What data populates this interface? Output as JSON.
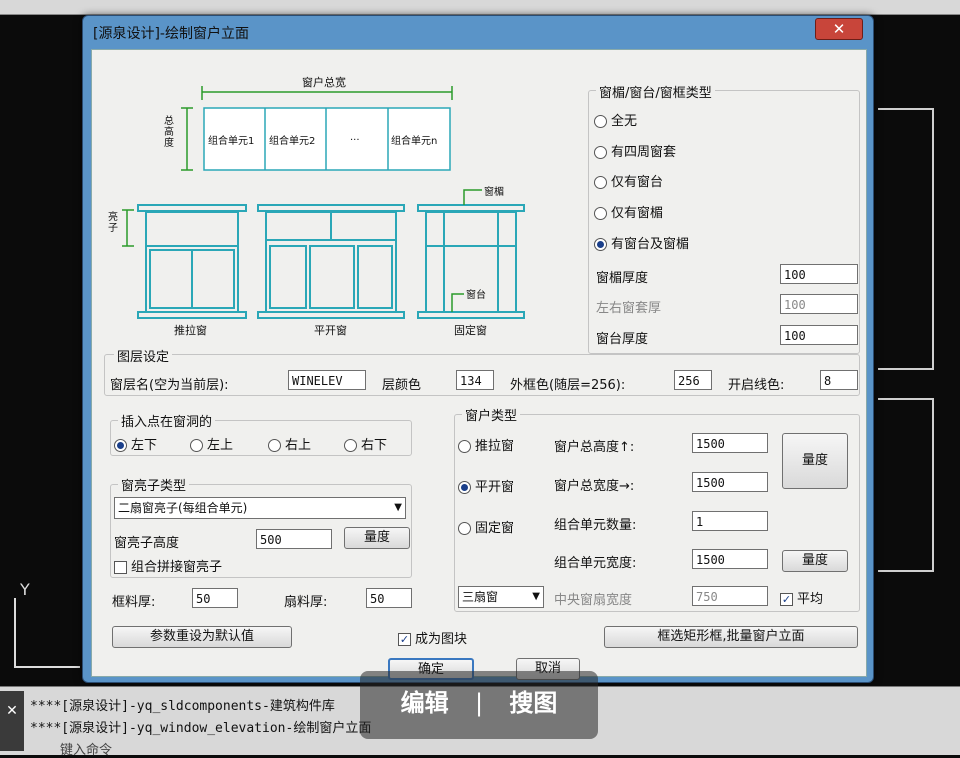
{
  "dialog": {
    "title": "[源泉设计]-绘制窗户立面",
    "close_label": "✕"
  },
  "diagram": {
    "total_label": "窗户总宽",
    "height_label": "总高度",
    "units": [
      "组合单元1",
      "组合单元2",
      "...",
      "组合单元n"
    ],
    "sash_label": "亮子",
    "hood_label": "窗楣",
    "sill_label": "窗台",
    "captions": [
      "推拉窗",
      "平开窗",
      "固定窗"
    ]
  },
  "window_type_group": {
    "legend": "窗楣/窗台/窗框类型",
    "options": [
      {
        "label": "全无",
        "checked": false
      },
      {
        "label": "有四周窗套",
        "checked": false
      },
      {
        "label": "仅有窗台",
        "checked": false
      },
      {
        "label": "仅有窗楣",
        "checked": false
      },
      {
        "label": "有窗台及窗楣",
        "checked": true
      }
    ],
    "hood_thickness_label": "窗楣厚度",
    "hood_thickness": "100",
    "side_thickness_label": "左右窗套厚",
    "side_thickness": "100",
    "sill_thickness_label": "窗台厚度",
    "sill_thickness": "100"
  },
  "layer_group": {
    "legend": "图层设定",
    "layer_name_label": "窗层名(空为当前层):",
    "layer_name": "WINELEV",
    "layer_color_label": "层颜色",
    "layer_color": "134",
    "frame_color_label": "外框色(随层=256):",
    "frame_color": "256",
    "open_color_label": "开启线色:",
    "open_color": "8"
  },
  "insert_group": {
    "legend": "插入点在窗洞的",
    "options": [
      {
        "label": "左下",
        "checked": true
      },
      {
        "label": "左上",
        "checked": false
      },
      {
        "label": "右上",
        "checked": false
      },
      {
        "label": "右下",
        "checked": false
      }
    ]
  },
  "transom_group": {
    "legend": "窗亮子类型",
    "selected": "二扇窗亮子(每组合单元)",
    "height_label": "窗亮子高度",
    "height": "500",
    "measure_label": "量度",
    "combine_label": "组合拼接窗亮子",
    "combine_checked": false
  },
  "frame": {
    "frame_thickness_label": "框料厚:",
    "frame_thickness": "50",
    "sash_thickness_label": "扇料厚:",
    "sash_thickness": "50"
  },
  "window_kind_group": {
    "legend": "窗户类型",
    "options": [
      {
        "label": "推拉窗",
        "checked": false
      },
      {
        "label": "平开窗",
        "checked": true
      },
      {
        "label": "固定窗",
        "checked": false
      }
    ],
    "total_height_label": "窗户总高度↑:",
    "total_height": "1500",
    "total_width_label": "窗户总宽度→:",
    "total_width": "1500",
    "unit_count_label": "组合单元数量:",
    "unit_count": "1",
    "unit_width_label": "组合单元宽度:",
    "unit_width": "1500",
    "measure_big_label": "量度",
    "measure_small_label": "量度",
    "leaf_select": "三扇窗",
    "center_width_label": "中央窗扇宽度",
    "center_width": "750",
    "average_label": "平均",
    "average_checked": true
  },
  "buttons": {
    "reset": "参数重设为默认值",
    "as_block_label": "成为图块",
    "as_block_checked": true,
    "batch": "框选矩形框,批量窗户立面",
    "ok": "确定",
    "cancel": "取消"
  },
  "command": {
    "line1": "****[源泉设计]-yq_sldcomponents-建筑构件库",
    "line2": "****[源泉设计]-yq_window_elevation-绘制窗户立面",
    "line3": "键入命令"
  },
  "overlay": {
    "edit": "编辑",
    "sep": "|",
    "search": "搜图"
  },
  "axis_label": "Y"
}
